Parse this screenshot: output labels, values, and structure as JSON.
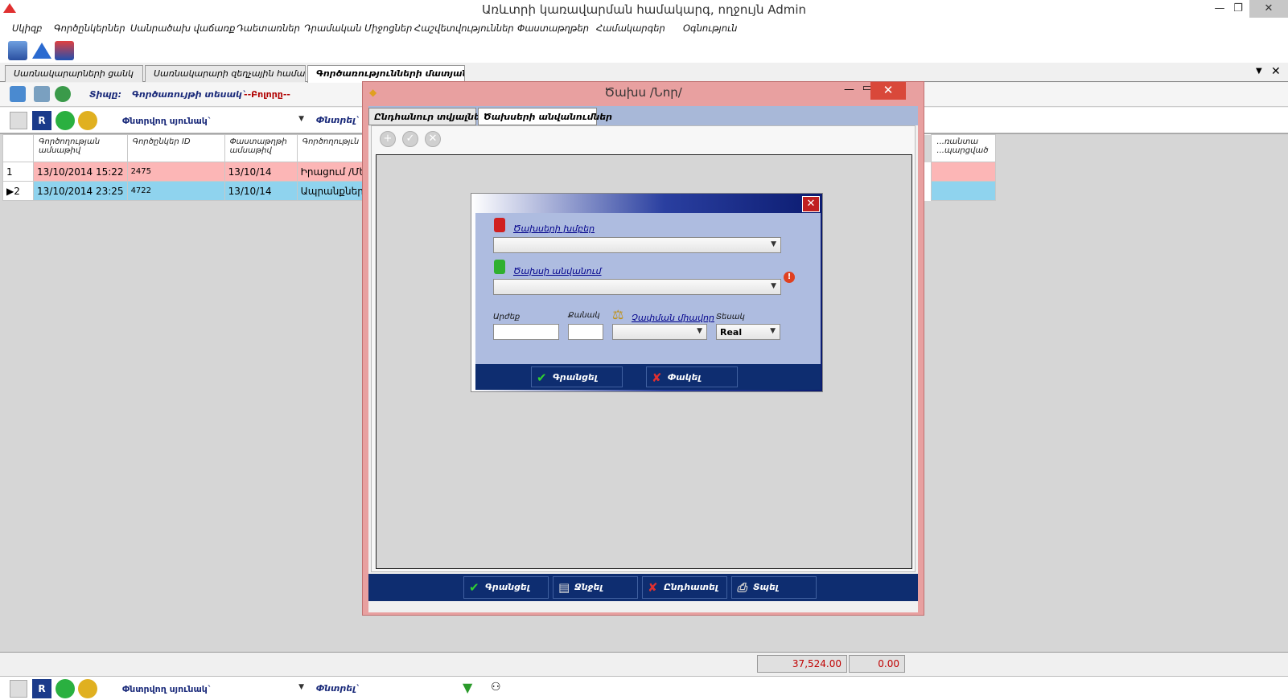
{
  "window": {
    "title": "Առևտրի կառավարման համակարգ, ողջույն Admin",
    "min": "—",
    "max": "❐",
    "close": "✕"
  },
  "menu": [
    "Սկիզբ",
    "Գործընկերներ",
    "Սանրածախ վաճառք",
    "Դաետառներ",
    "Դրամական Միջոցներ",
    "Հաշվետվություններ",
    "Փաստաթղթեր",
    "Համակարգեր",
    "Օգնություն"
  ],
  "tabs": [
    "Սառնակարարների ցանկ",
    "Սառնակարարի զեղչային համակ...",
    "Գործառությունների մատյան"
  ],
  "filter": {
    "type_label": "Տիպը:",
    "op_type_label": "Գործառույթի տեսակ`",
    "op_type_value": "--Բոլորը--"
  },
  "search": {
    "field_label": "Փնտրվող սյունակ`",
    "search_label": "Փնտրել`"
  },
  "grid": {
    "columns": [
      "Գործողության ամսաթիվ",
      "Գործընկեր ID",
      "Փաստաթղթի ամսաթիվ",
      "Գործողությւն",
      "...ռանտա ...պարցված"
    ],
    "rows": [
      {
        "num": "1",
        "date": "13/10/2014 15:22",
        "partner": "2475",
        "doc_date": "13/10/14",
        "op": "Իրացում /Մե"
      },
      {
        "num": "2",
        "date": "13/10/2014 23:25",
        "partner": "4722",
        "doc_date": "13/10/14",
        "op": "Ապրանքների"
      }
    ]
  },
  "totals": {
    "sum1": "37,524.00",
    "sum2": "0.00"
  },
  "dialog": {
    "title": "Ծախս /Նոր/",
    "tabs": [
      "Ընդհանուր տվյալներ",
      "Ծախսերի անվանումներ"
    ],
    "buttons": [
      "Գրանցել",
      "Ջնջել",
      "Ընդհատել",
      "Տպել"
    ]
  },
  "modal": {
    "group_label": "Ծախսերի խմբեր",
    "name_label": "Ծախսի անվանում",
    "value_label": "Արժեք",
    "qty_label": "Քանակ",
    "unit_label": "Չափման միավոր",
    "type_label": "Տեսակ",
    "type_value": "Real",
    "ok": "Գրանցել",
    "cancel": "Փակել"
  }
}
